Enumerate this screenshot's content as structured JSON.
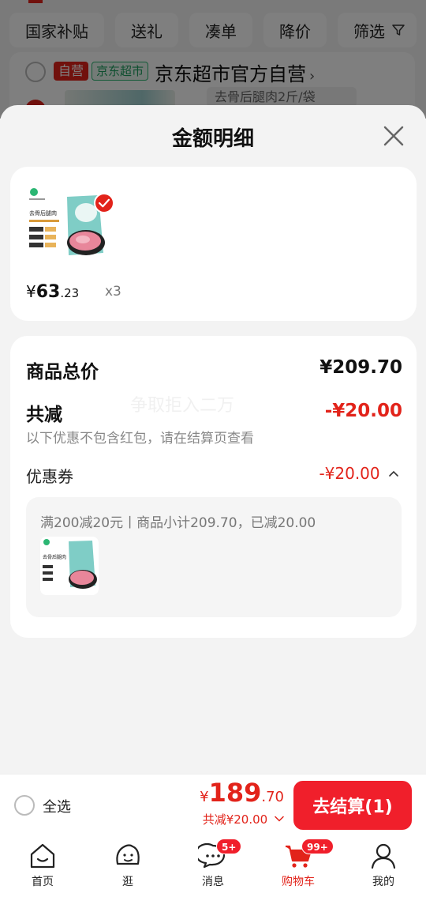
{
  "background": {
    "filters": [
      "国家补贴",
      "送礼",
      "凑单",
      "降价",
      "筛选"
    ],
    "tag_self": "自营",
    "tag_market": "京东超市",
    "store_name": "京东超市官方自营",
    "spec_text": "去骨后腿肉2斤/袋",
    "filter_icon": "funnel-icon"
  },
  "sheet": {
    "title": "金额明细",
    "close_icon": "close-icon",
    "product": {
      "currency": "¥",
      "price_int": "63",
      "price_dec": ".23",
      "quantity": "x3",
      "img_text": "去骨后腿肉"
    },
    "summary": {
      "total_label": "商品总价",
      "total_value": "¥209.70",
      "discount_label": "共减",
      "discount_value": "-¥20.00",
      "note": "以下优惠不包含红包，请在结算页查看",
      "coupon_label": "优惠券",
      "coupon_value": "-¥20.00",
      "coupon_detail": "满200减20元丨商品小计209.70，已减20.00",
      "watermark": "争取拒入二万"
    }
  },
  "checkout": {
    "select_all": "全选",
    "currency": "¥",
    "price_int": "189",
    "price_dec": ".70",
    "discount": "共减¥20.00",
    "button": "去结算(1)"
  },
  "nav": {
    "items": [
      {
        "label": "首页",
        "icon": "home-icon"
      },
      {
        "label": "逛",
        "icon": "browse-icon"
      },
      {
        "label": "消息",
        "icon": "message-icon",
        "badge": "5+"
      },
      {
        "label": "购物车",
        "icon": "cart-icon",
        "badge": "99+"
      },
      {
        "label": "我的",
        "icon": "profile-icon"
      }
    ]
  },
  "colors": {
    "accent": "#e2231a",
    "green": "#2bb673"
  }
}
